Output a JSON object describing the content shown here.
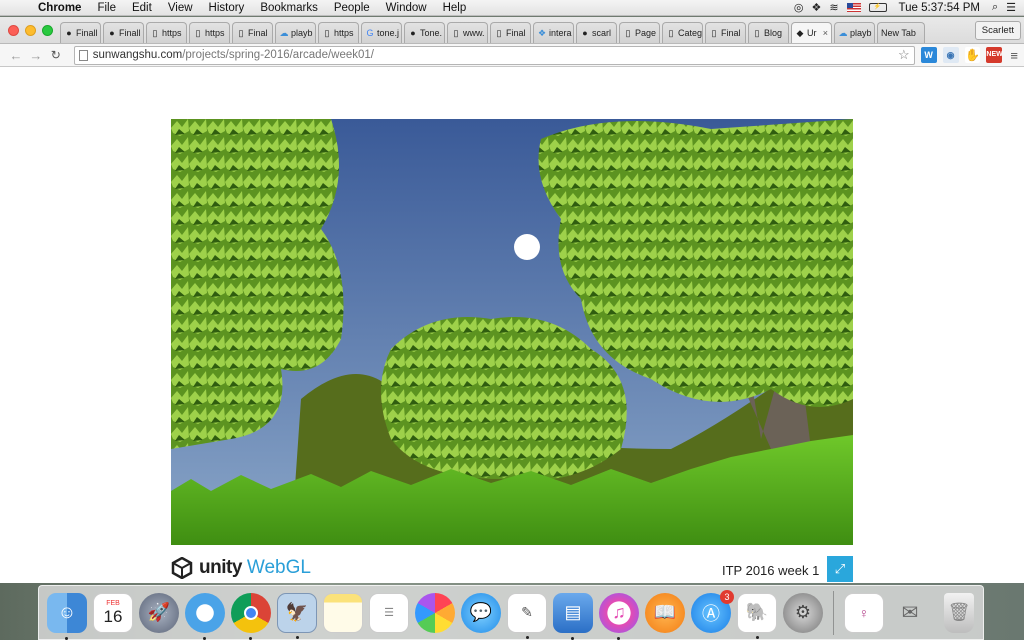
{
  "menubar": {
    "app": "Chrome",
    "items": [
      "File",
      "Edit",
      "View",
      "History",
      "Bookmarks",
      "People",
      "Window",
      "Help"
    ],
    "clock": "Tue 5:37:54 PM"
  },
  "tabs": [
    {
      "label": "Finall",
      "icon": "github-icon"
    },
    {
      "label": "Finall",
      "icon": "github-icon"
    },
    {
      "label": "https",
      "icon": "page-icon"
    },
    {
      "label": "https",
      "icon": "page-icon"
    },
    {
      "label": "Final",
      "icon": "page-icon"
    },
    {
      "label": "playb",
      "icon": "cloud-icon"
    },
    {
      "label": "https",
      "icon": "page-icon"
    },
    {
      "label": "tone.j",
      "icon": "google-icon"
    },
    {
      "label": "Tone.",
      "icon": "github-icon"
    },
    {
      "label": "www.",
      "icon": "page-icon"
    },
    {
      "label": "Final",
      "icon": "page-icon"
    },
    {
      "label": "intera",
      "icon": "dropbox-icon"
    },
    {
      "label": "scarl",
      "icon": "github-icon"
    },
    {
      "label": "Page",
      "icon": "page-icon"
    },
    {
      "label": "Categ",
      "icon": "page-icon"
    },
    {
      "label": "Final",
      "icon": "page-icon"
    },
    {
      "label": "Blog",
      "icon": "page-icon"
    },
    {
      "label": "Ur",
      "icon": "unity-icon",
      "active": true
    },
    {
      "label": "playb",
      "icon": "cloud-icon"
    },
    {
      "label": "New Tab",
      "icon": ""
    }
  ],
  "profile": "Scarlett",
  "omnibox": {
    "url_host": "sunwangshu.com",
    "url_path": "/projects/spring-2016/arcade/week01/"
  },
  "game": {
    "footer_brand": "unity",
    "footer_brand_suffix": "WebGL",
    "title": "ITP 2016 week 1",
    "colors": {
      "sky_top": "#3a5a98",
      "sky_bottom": "#8aa6c8",
      "grass": "#4fa318",
      "leaves": "#5f9a22",
      "hill": "#566d1c",
      "accent": "#2aa7dc"
    }
  },
  "dock": {
    "calendar_month": "FEB",
    "calendar_day": "16",
    "appstore_badge": "3",
    "items": [
      "finder-icon",
      "calendar-icon",
      "launchpad-icon",
      "safari-icon",
      "chrome-icon",
      "preview-icon",
      "notes-icon",
      "reminders-icon",
      "photos-icon",
      "messages-icon",
      "textedit-icon",
      "keynote-icon",
      "itunes-icon",
      "ibooks-icon",
      "appstore-icon",
      "evernote-icon",
      "system-preferences-icon",
      "document-icon",
      "mail-document-icon",
      "trash-icon"
    ]
  }
}
